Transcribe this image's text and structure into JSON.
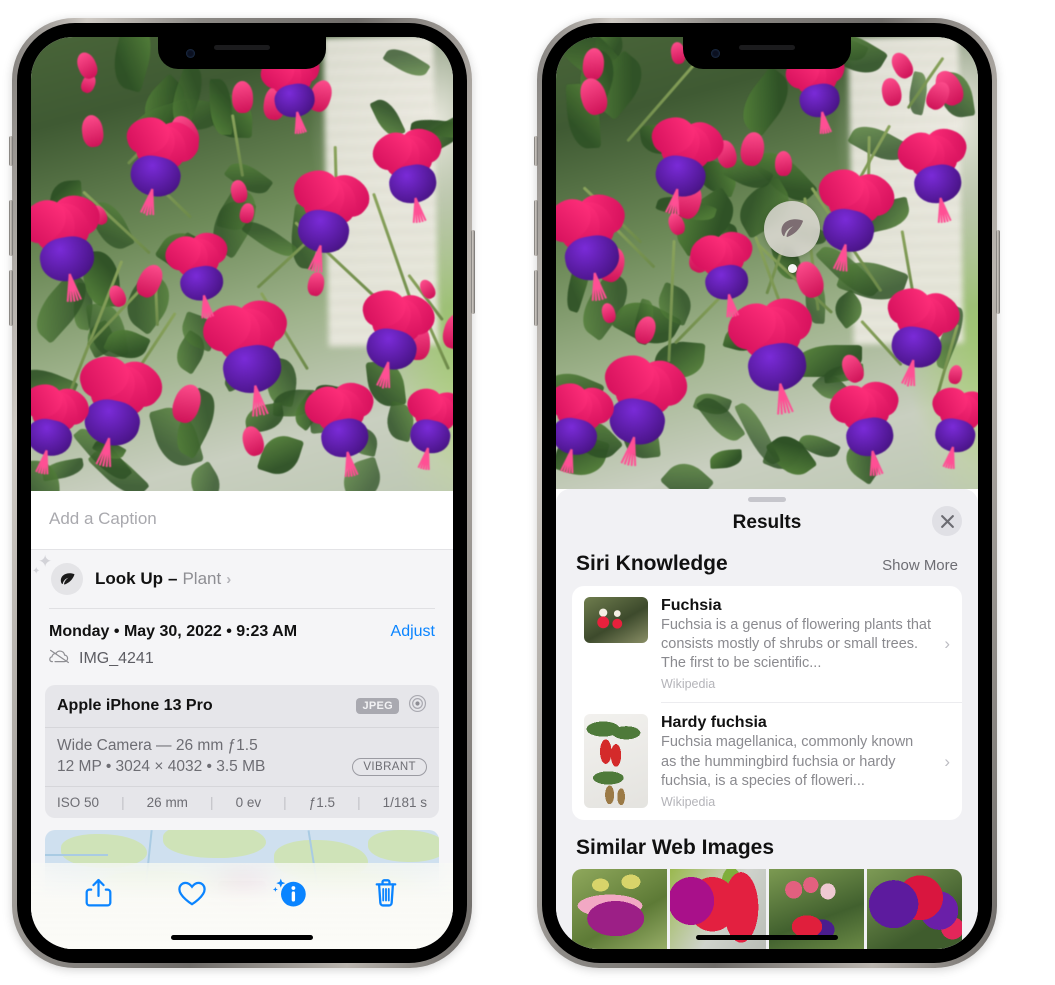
{
  "colors": {
    "accent_blue": "#0a84ff",
    "sheet_bg": "#f5f5f7",
    "results_bg": "#f1f1f4",
    "card_white": "#ffffff",
    "secondary_text": "#8e8e93",
    "exif_card": "#e6e6ea"
  },
  "left_phone": {
    "caption": {
      "placeholder": "Add a Caption",
      "value": ""
    },
    "lookup": {
      "icon": "leaf-icon",
      "sparkle_icon": "sparkles-icon",
      "label": "Look Up",
      "separator": "–",
      "subject": "Plant",
      "chevron": "chevron-right-icon"
    },
    "meta": {
      "date": "Monday • May 30, 2022 • 9:23 AM",
      "adjust_label": "Adjust",
      "cloud_icon": "cloud-slash-icon",
      "filename": "IMG_4241"
    },
    "exif": {
      "device": "Apple iPhone 13 Pro",
      "format_badge": "JPEG",
      "aperture_icon": "aperture-icon",
      "lens_line": "Wide Camera — 26 mm ƒ1.5",
      "size_line": "12 MP • 3024 × 4032 • 3.5 MB",
      "style_badge": "VIBRANT",
      "stats": [
        "ISO 50",
        "26 mm",
        "0 ev",
        "ƒ1.5",
        "1/181 s"
      ]
    },
    "toolbar": [
      {
        "name": "share-button",
        "icon": "share-icon",
        "label": "Share"
      },
      {
        "name": "favorite-button",
        "icon": "heart-icon",
        "label": "Favorite"
      },
      {
        "name": "info-button",
        "icon": "info-sparkle-icon",
        "label": "Info"
      },
      {
        "name": "delete-button",
        "icon": "trash-icon",
        "label": "Delete"
      }
    ]
  },
  "right_phone": {
    "visual_lookup_badge": {
      "icon": "leaf-icon",
      "label": "Visual Look Up"
    },
    "sheet": {
      "grabber": "drag-handle",
      "title": "Results",
      "close_icon": "close-icon"
    },
    "siri_knowledge": {
      "title": "Siri Knowledge",
      "show_more": "Show More",
      "items": [
        {
          "title": "Fuchsia",
          "description": "Fuchsia is a genus of flowering plants that consists mostly of shrubs or small trees. The first to be scientific...",
          "source": "Wikipedia",
          "chevron": "chevron-right-icon"
        },
        {
          "title": "Hardy fuchsia",
          "description": "Fuchsia magellanica, commonly known as the hummingbird fuchsia or hardy fuchsia, is a species of floweri...",
          "source": "Wikipedia",
          "chevron": "chevron-right-icon"
        }
      ]
    },
    "similar_web_images": {
      "title": "Similar Web Images",
      "thumbnails": [
        {
          "name": "web-image-1"
        },
        {
          "name": "web-image-2"
        },
        {
          "name": "web-image-3"
        },
        {
          "name": "web-image-4"
        }
      ]
    }
  }
}
